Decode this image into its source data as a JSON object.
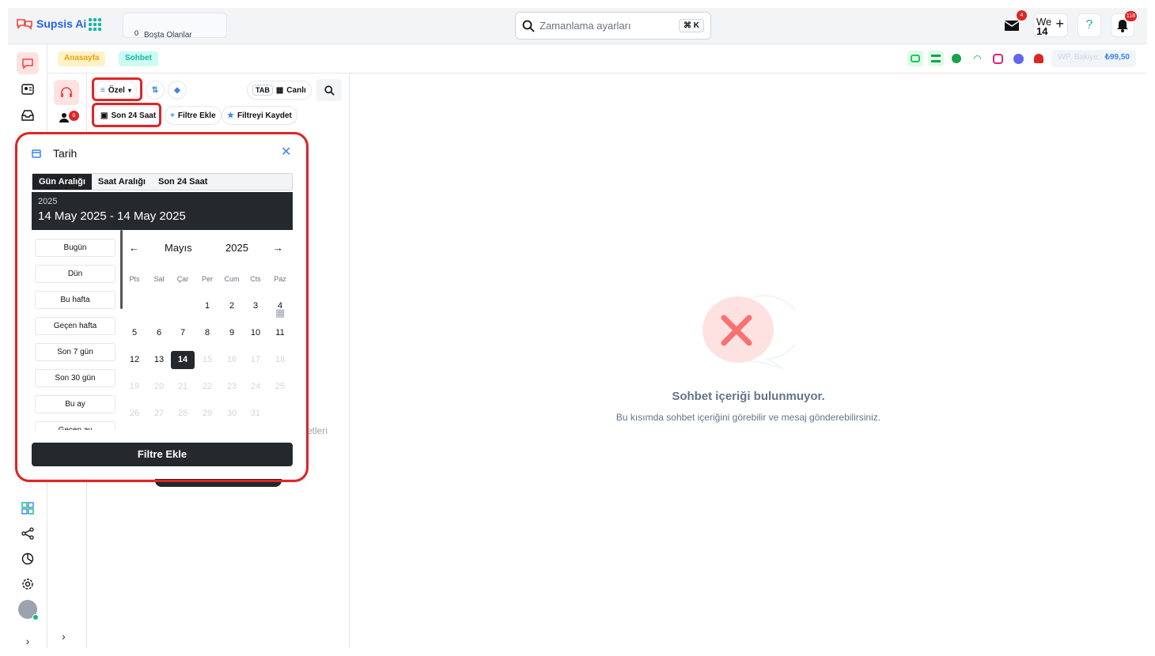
{
  "topbar": {
    "brand": "Supsis Ai",
    "online_count": "0",
    "online_label": "Boşta Olanlar",
    "search_placeholder": "Zamanlama ayarları",
    "search_shortcut": "⌘ K",
    "mail_badge": "4",
    "workspace_line1": "We",
    "workspace_line2": "14",
    "notification_badge": "118"
  },
  "sidebar": {
    "items": [
      "chat-icon",
      "contacts-icon",
      "inbox-icon",
      "dashboard-icon",
      "share-icon",
      "reports-icon",
      "settings-icon",
      "avatar"
    ]
  },
  "tabs": [
    {
      "label": "Anasayfa",
      "color": "#f59e0b"
    },
    {
      "label": "Sohbet",
      "color": "#14b8a6"
    }
  ],
  "wallet": {
    "label": "WP. Bakiye:",
    "value": "₺99,50"
  },
  "list": {
    "agents_badge": "0",
    "filter_label": "Özel",
    "tab_key": "TAB",
    "live_label": "Canlı",
    "date_chip": "Son 24 Saat",
    "add_filter": "Filtre Ekle",
    "save_filter": "Filtreyi Kaydet",
    "behind_text": "etleri"
  },
  "date_popup": {
    "title": "Tarih",
    "modes": [
      "Gün Aralığı",
      "Saat Aralığı",
      "Son 24 Saat"
    ],
    "active_mode": "Gün Aralığı",
    "year": "2025",
    "range": "14 May 2025 - 14 May 2025",
    "presets": [
      "Bugün",
      "Dün",
      "Bu hafta",
      "Geçen hafta",
      "Son 7 gün",
      "Son 30 gün",
      "Bu ay",
      "Geçen ay"
    ],
    "month": "Mayıs",
    "month_year": "2025",
    "weekdays": [
      "Pts",
      "Sal",
      "Çar",
      "Per",
      "Cum",
      "Cts",
      "Paz"
    ],
    "weeks": [
      [
        "",
        "",
        "",
        "1",
        "2",
        "3",
        "4"
      ],
      [
        "5",
        "6",
        "7",
        "8",
        "9",
        "10",
        "11"
      ],
      [
        "12",
        "13",
        "14",
        "15",
        "16",
        "17",
        "18"
      ],
      [
        "19",
        "20",
        "21",
        "22",
        "23",
        "24",
        "25"
      ],
      [
        "26",
        "27",
        "28",
        "29",
        "30",
        "31",
        ""
      ]
    ],
    "selected_day": "14",
    "apply_label": "Filtre Ekle"
  },
  "empty_state": {
    "title": "Sohbet içeriği bulunmuyor.",
    "subtitle": "Bu kısımda sohbet içeriğini görebilir ve mesaj gönderebilirsiniz."
  }
}
